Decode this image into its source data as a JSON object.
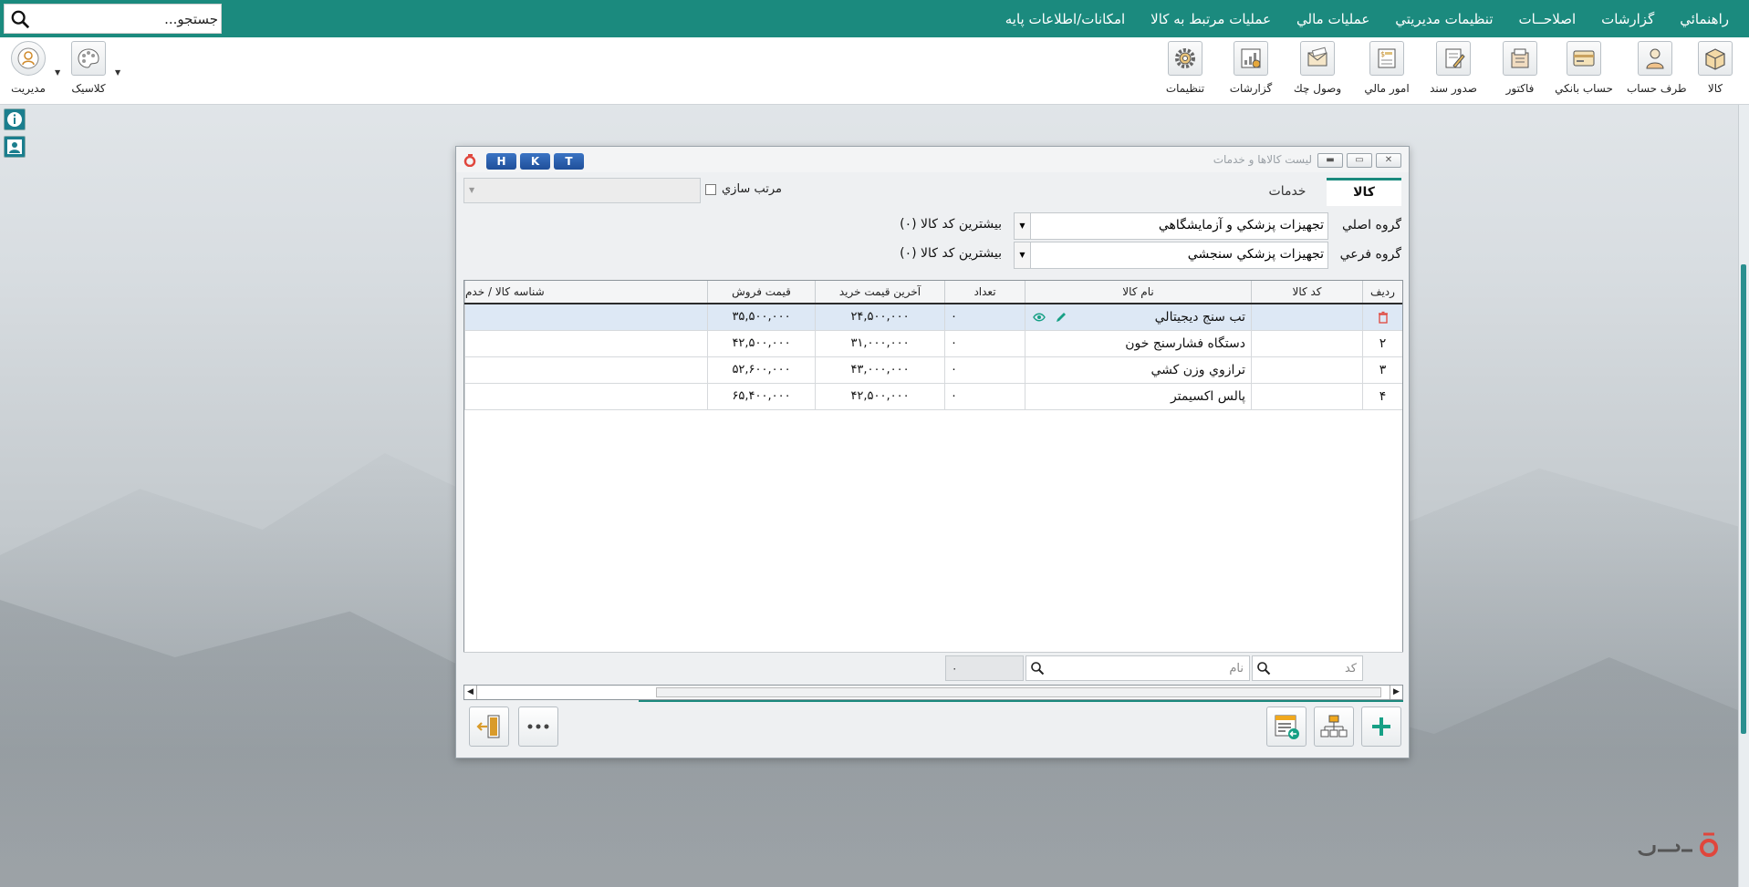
{
  "search": {
    "placeholder": "جستجو..."
  },
  "menu": [
    "امکانات/اطلاعات پايه",
    "عمليات مرتبط به کالا",
    "عمليات مالي",
    "تنظيمات مديريتي",
    "اصلاحــات",
    "گزارشات",
    "راهنمائي"
  ],
  "toolbar": {
    "kala": "کالا",
    "taraf_hesab": "طرف حساب",
    "hesab_banki": "حساب بانکي",
    "factor": "فاکتور",
    "sodoor_sanad": "صدور سند",
    "omoor_mali": "امور مالي",
    "vosool_chek": "وصول چك",
    "gozareshat": "گزارشات",
    "tanzimat": "تنظيمات",
    "classic": "کلاسیک",
    "modiriat": "مدیریت"
  },
  "dialog": {
    "title": "ليست کالاها و خدمات",
    "hkt": [
      "H",
      "K",
      "T"
    ],
    "tabs": {
      "kala": "کالا",
      "khadamat": "خدمات"
    },
    "sort_label": "مرتب سازي",
    "main_group_label": "گروه اصلي",
    "main_group_value": "تجهيزات پزشکي و آزمايشگاهي",
    "main_group_hint": "بيشترين کد کالا (۰)",
    "sub_group_label": "گروه فرعي",
    "sub_group_value": "تجهيزات پزشکي سنجشي",
    "sub_group_hint": "بيشترين کد کالا (۰)",
    "columns": {
      "radif": "رديف",
      "code": "کد کالا",
      "name": "نام کالا",
      "count": "تعداد",
      "last_buy": "آخرين قيمت خريد",
      "sell": "قيمت فروش",
      "id": "شناسه کالا / خدم"
    },
    "rows": [
      {
        "radif": "",
        "name": "تب سنج ديجيتالي",
        "count": "۰",
        "last_buy": "۲۴,۵۰۰,۰۰۰",
        "sell": "۳۵,۵۰۰,۰۰۰"
      },
      {
        "radif": "۲",
        "name": "دستگاه فشارسنج خون",
        "count": "۰",
        "last_buy": "۳۱,۰۰۰,۰۰۰",
        "sell": "۴۲,۵۰۰,۰۰۰"
      },
      {
        "radif": "۳",
        "name": "ترازوي وزن کشي",
        "count": "۰",
        "last_buy": "۴۳,۰۰۰,۰۰۰",
        "sell": "۵۲,۶۰۰,۰۰۰"
      },
      {
        "radif": "۴",
        "name": "پالس اکسيمتر",
        "count": "۰",
        "last_buy": "۴۲,۵۰۰,۰۰۰",
        "sell": "۶۵,۴۰۰,۰۰۰"
      }
    ],
    "filter": {
      "code_placeholder": "کد",
      "name_placeholder": "نام",
      "count": "۰"
    }
  },
  "colors": {
    "teal": "#1b8a7e",
    "accent_green": "#16a085",
    "delete_red": "#e0463c"
  }
}
